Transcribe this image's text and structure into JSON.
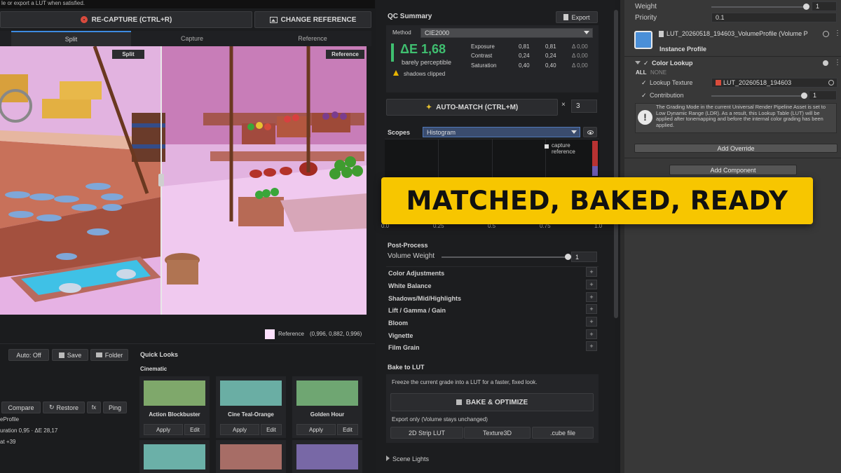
{
  "top_hint": "le or export a LUT when satisfied.",
  "toolbar": {
    "recapture": "RE-CAPTURE (CTRL+R)",
    "change_reference": "CHANGE REFERENCE"
  },
  "view_tabs": [
    "Split",
    "Capture",
    "Reference"
  ],
  "viewport": {
    "split_label": "Split",
    "reference_label": "Reference"
  },
  "ref_pixel": {
    "label": "Reference",
    "value": "(0,996, 0,882, 0,996)",
    "color": "#fde1fd"
  },
  "bottom_left": {
    "auto": "Auto: Off",
    "save": "Save",
    "folder": "Folder",
    "compare": "Compare",
    "restore": "Restore",
    "fx": "fx",
    "ping": "Ping",
    "profile": "eProfile",
    "line1": "uration 0,95 · ΔE 28,17",
    "line2": "at +39"
  },
  "quick_looks": {
    "title": "Quick Looks",
    "category": "Cinematic",
    "apply": "Apply",
    "edit": "Edit",
    "cards": [
      {
        "name": "Action Blockbuster",
        "color": "#7fa86b"
      },
      {
        "name": "Cine Teal-Orange",
        "color": "#6aaea4"
      },
      {
        "name": "Golden Hour",
        "color": "#6fa672"
      },
      {
        "name": "",
        "color": "#6bb0a8"
      },
      {
        "name": "",
        "color": "#a76d66"
      },
      {
        "name": "",
        "color": "#7868a6"
      }
    ]
  },
  "qc": {
    "title": "QC Summary",
    "export": "Export",
    "method_label": "Method",
    "method_value": "CIE2000",
    "delta": "ΔE 1,68",
    "delta_desc": "barely perceptible",
    "warning": "shadows clipped",
    "metrics": [
      {
        "name": "Exposure",
        "a": "0,81",
        "b": "0,81",
        "d": "Δ 0,00"
      },
      {
        "name": "Contrast",
        "a": "0,24",
        "b": "0,24",
        "d": "Δ 0,00"
      },
      {
        "name": "Saturation",
        "a": "0,40",
        "b": "0,40",
        "d": "Δ 0,00"
      }
    ]
  },
  "auto_match": {
    "label": "AUTO-MATCH (CTRL+M)",
    "x": "×",
    "iterations": "3"
  },
  "scopes": {
    "label": "Scopes",
    "mode": "Histogram",
    "legend_capture": "capture",
    "legend_reference": "reference",
    "ticks": [
      "0.0",
      "0.25",
      "0.5",
      "0.75",
      "1.0"
    ]
  },
  "overlay": "MATCHED, BAKED, READY",
  "post_process": {
    "title": "Post-Process",
    "volume_weight_label": "Volume Weight",
    "volume_weight_value": "1",
    "items": [
      "Color Adjustments",
      "White Balance",
      "Shadows/Mid/Highlights",
      "Lift / Gamma / Gain",
      "Bloom",
      "Vignette",
      "Film Grain"
    ]
  },
  "bake": {
    "title": "Bake to LUT",
    "desc": "Freeze the current grade into a LUT for a faster, fixed look.",
    "button": "BAKE & OPTIMIZE",
    "export_note": "Export only (Volume stays unchanged)",
    "formats": [
      "2D Strip LUT",
      "Texture3D",
      ".cube file"
    ]
  },
  "scene_lights": "Scene Lights",
  "inspector": {
    "weight_label": "Weight",
    "weight_value": "1",
    "priority_label": "Priority",
    "priority_value": "0.1",
    "profile_name": "LUT_20260518_194603_VolumeProfile (Volume P",
    "instance_profile": "Instance Profile",
    "component": "Color Lookup",
    "all": "ALL",
    "none": "NONE",
    "lookup_texture_label": "Lookup Texture",
    "lookup_texture_value": "LUT_20260518_194603",
    "contribution_label": "Contribution",
    "contribution_value": "1",
    "info": "The Grading Mode in the current Universal Render Pipeline Asset is set to Low Dynamic Range (LDR). As a result, this Lookup Table (LUT) will be applied after tonemapping and before the internal color grading has been applied.",
    "add_override": "Add Override",
    "add_component": "Add Component"
  },
  "colors": {
    "accent_green": "#3fbf70",
    "overlay_yellow": "#f7c600"
  }
}
